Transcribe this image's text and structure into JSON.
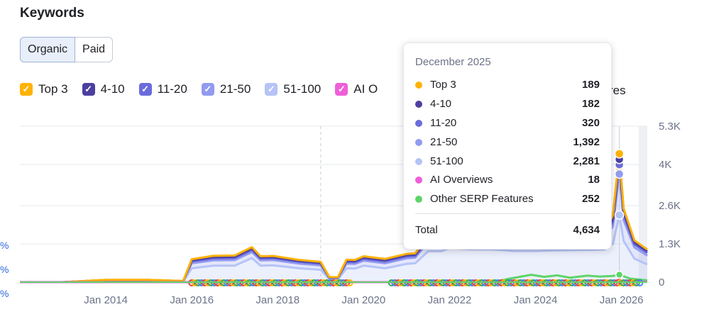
{
  "page": {
    "title": "Keywords"
  },
  "tabs": [
    {
      "label": "Organic"
    },
    {
      "label": "Paid"
    }
  ],
  "legend": [
    {
      "label": "Top 3",
      "color": "#ffb200"
    },
    {
      "label": "4-10",
      "color": "#4b3fa0"
    },
    {
      "label": "11-20",
      "color": "#6b6bdc"
    },
    {
      "label": "21-50",
      "color": "#929bef"
    },
    {
      "label": "51-100",
      "color": "#b5c3f7"
    },
    {
      "label": "AI O",
      "color": "#ee5fd9"
    },
    {
      "label": "res",
      "color": "#ffffff"
    }
  ],
  "left_edge": [
    "%",
    "%",
    "%"
  ],
  "tooltip": {
    "title": "December 2025",
    "rows": [
      {
        "label": "Top 3",
        "value": "189",
        "color": "#ffb200"
      },
      {
        "label": "4-10",
        "value": "182",
        "color": "#4b3fa0"
      },
      {
        "label": "11-20",
        "value": "320",
        "color": "#6b6bdc"
      },
      {
        "label": "21-50",
        "value": "1,392",
        "color": "#929bef"
      },
      {
        "label": "51-100",
        "value": "2,281",
        "color": "#b5c3f7"
      },
      {
        "label": "AI Overviews",
        "value": "18",
        "color": "#ee5fd9"
      },
      {
        "label": "Other SERP Features",
        "value": "252",
        "color": "#5ed46a"
      }
    ],
    "total_label": "Total",
    "total_value": "4,634"
  },
  "chart_data": {
    "type": "area",
    "stacked": true,
    "x_ticks": [
      "Jan 2014",
      "Jan 2016",
      "Jan 2018",
      "Jan 2020",
      "Jan 2022",
      "Jan 2024",
      "Jan 2026"
    ],
    "y_ticks": [
      "5.3K",
      "4K",
      "2.6K",
      "1.3K",
      "0"
    ],
    "ylim": [
      0,
      5300
    ],
    "y_axis_position": "right",
    "grid": true,
    "x": [
      2012.0,
      2013.0,
      2014.0,
      2015.0,
      2015.8,
      2016.0,
      2016.5,
      2017.0,
      2017.4,
      2017.6,
      2017.9,
      2018.5,
      2019.0,
      2019.2,
      2019.4,
      2019.6,
      2019.8,
      2020.0,
      2020.5,
      2021.0,
      2021.2,
      2021.5,
      2021.8,
      2022.0,
      2022.5,
      2023.0,
      2023.5,
      2024.0,
      2024.5,
      2025.0,
      2025.4,
      2025.6,
      2025.8,
      2025.95,
      2026.05,
      2026.3,
      2026.6
    ],
    "series": [
      {
        "name": "51-100",
        "color": "#b5c3f7",
        "values": [
          0,
          0,
          40,
          40,
          20,
          470,
          560,
          560,
          820,
          560,
          570,
          470,
          420,
          100,
          90,
          470,
          460,
          560,
          470,
          620,
          640,
          1050,
          1050,
          1160,
          1110,
          1110,
          1060,
          1060,
          1080,
          1090,
          1100,
          1110,
          1300,
          2281,
          1400,
          800,
          600
        ]
      },
      {
        "name": "21-50",
        "color": "#929bef",
        "values": [
          0,
          0,
          20,
          20,
          10,
          170,
          180,
          190,
          200,
          180,
          180,
          160,
          150,
          40,
          40,
          160,
          160,
          170,
          170,
          190,
          190,
          320,
          320,
          330,
          330,
          330,
          330,
          330,
          330,
          340,
          350,
          360,
          600,
          1392,
          700,
          380,
          300
        ]
      },
      {
        "name": "11-20",
        "color": "#6b6bdc",
        "values": [
          0,
          0,
          8,
          8,
          4,
          60,
          65,
          65,
          70,
          60,
          60,
          55,
          50,
          15,
          15,
          55,
          55,
          60,
          60,
          60,
          60,
          80,
          80,
          90,
          90,
          90,
          90,
          90,
          90,
          90,
          95,
          100,
          160,
          320,
          170,
          100,
          90
        ]
      },
      {
        "name": "4-10",
        "color": "#4b3fa0",
        "values": [
          0,
          0,
          6,
          6,
          3,
          40,
          45,
          45,
          50,
          40,
          40,
          35,
          35,
          10,
          10,
          40,
          40,
          45,
          45,
          45,
          45,
          60,
          60,
          60,
          60,
          60,
          60,
          60,
          60,
          60,
          65,
          70,
          100,
          182,
          110,
          70,
          60
        ]
      },
      {
        "name": "Top 3",
        "color": "#ffb200",
        "values": [
          0,
          0,
          5,
          5,
          3,
          40,
          45,
          45,
          50,
          40,
          40,
          35,
          35,
          10,
          10,
          40,
          40,
          45,
          45,
          45,
          45,
          60,
          60,
          60,
          60,
          60,
          60,
          60,
          60,
          60,
          65,
          70,
          110,
          189,
          120,
          70,
          60
        ]
      }
    ],
    "overlay_series": [
      {
        "name": "Other SERP Features",
        "color": "#5ed46a",
        "x": [
          2012.0,
          2023.0,
          2023.4,
          2023.9,
          2024.2,
          2024.5,
          2024.8,
          2025.2,
          2025.5,
          2025.8,
          2025.95,
          2026.2,
          2026.6
        ],
        "values": [
          0,
          0,
          120,
          250,
          180,
          230,
          150,
          220,
          190,
          210,
          252,
          120,
          60
        ]
      },
      {
        "name": "AI Overviews",
        "color": "#ee5fd9",
        "x": [
          2012.0,
          2024.8,
          2025.2,
          2025.6,
          2025.95,
          2026.3,
          2026.6
        ],
        "values": [
          0,
          0,
          5,
          10,
          18,
          15,
          10
        ]
      }
    ],
    "highlight_x": 2025.95,
    "dashed_marker_x": 2019.0
  }
}
